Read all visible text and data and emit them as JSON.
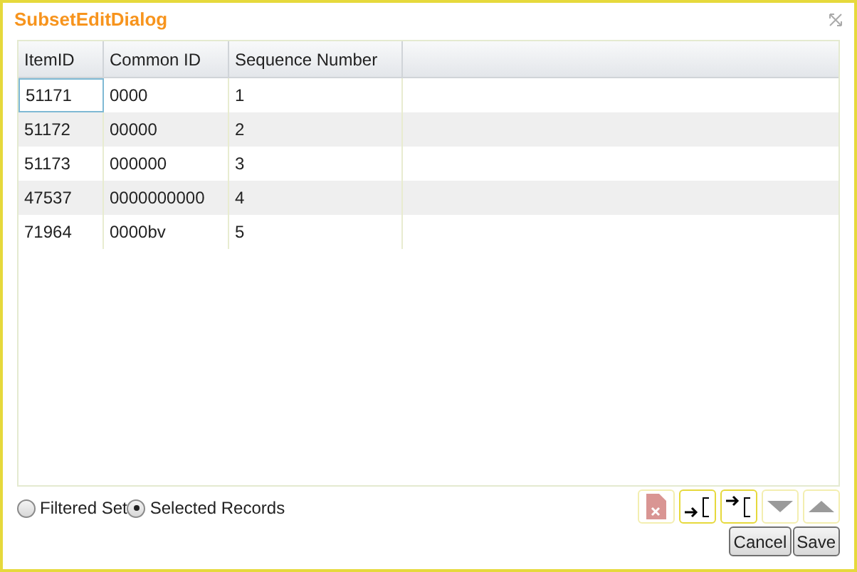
{
  "window": {
    "title": "SubsetEditDialog"
  },
  "table": {
    "columns": [
      "ItemID",
      "Common ID",
      "Sequence Number"
    ],
    "rows": [
      {
        "cells": [
          "51171",
          "0000",
          "1"
        ],
        "selected": true
      },
      {
        "cells": [
          "51172",
          "00000",
          "2"
        ],
        "selected": false
      },
      {
        "cells": [
          "51173",
          "000000",
          "3"
        ],
        "selected": false
      },
      {
        "cells": [
          "47537",
          "0000000000",
          "4"
        ],
        "selected": false
      },
      {
        "cells": [
          "71964",
          "0000bv",
          "5"
        ],
        "selected": false
      }
    ]
  },
  "scope_options": [
    {
      "label": "Filtered Set",
      "selected": false
    },
    {
      "label": "Selected Records",
      "selected": true
    }
  ],
  "tools": [
    {
      "kind": "delete",
      "disabled": true
    },
    {
      "kind": "insert-after",
      "disabled": false
    },
    {
      "kind": "insert-before",
      "disabled": false
    },
    {
      "kind": "move-down",
      "disabled": true
    },
    {
      "kind": "move-up",
      "disabled": true
    }
  ],
  "buttons": [
    "Cancel",
    "Save"
  ]
}
